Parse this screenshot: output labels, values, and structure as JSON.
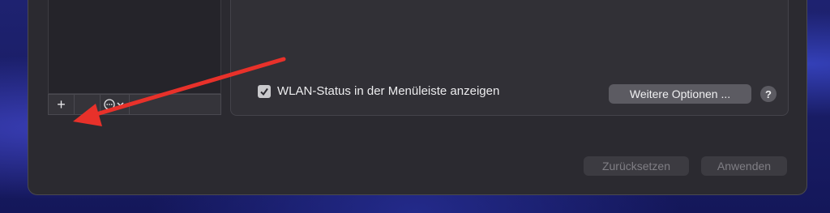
{
  "checkbox": {
    "label": "WLAN-Status in der Menüleiste anzeigen",
    "checked": true
  },
  "buttons": {
    "more_options": "Weitere Optionen ...",
    "help": "?",
    "reset": "Zurücksetzen",
    "apply": "Anwenden"
  },
  "list_toolbar": {
    "add": "+",
    "remove": "",
    "actions_icon": "ellipsis-circle-icon"
  },
  "colors": {
    "annotation_arrow": "#e8312a",
    "window_bg": "#2b2a30"
  }
}
